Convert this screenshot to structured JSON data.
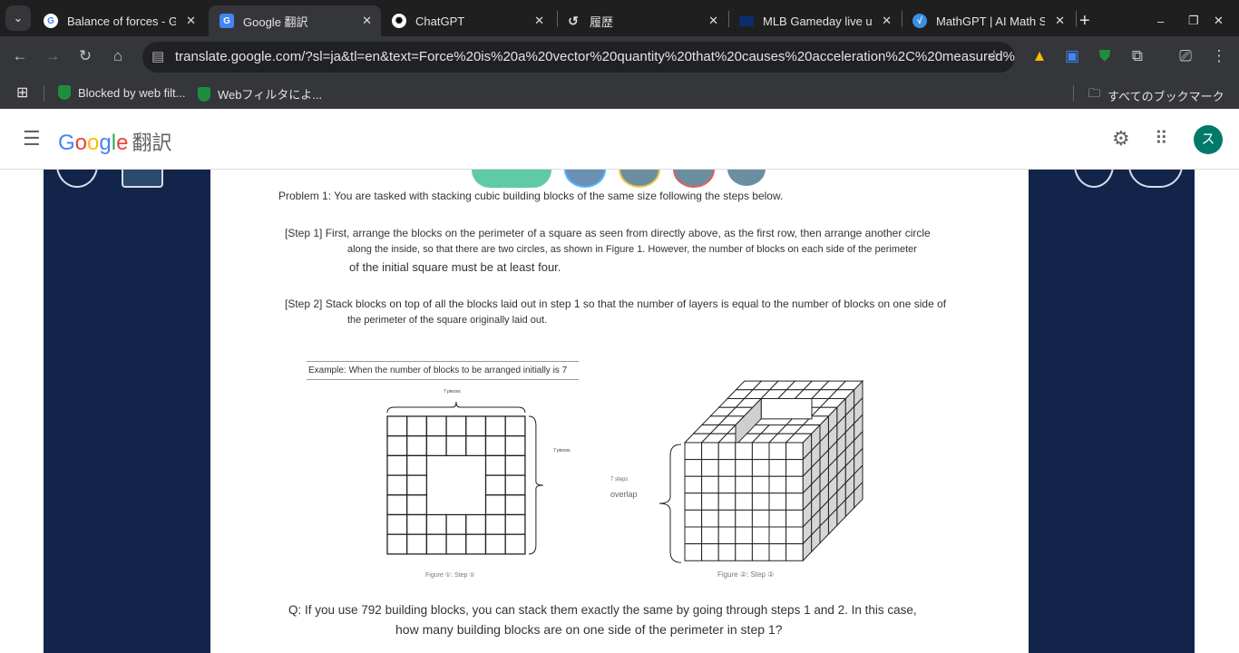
{
  "browser": {
    "tabs": [
      {
        "title": "Balance of forces - G",
        "icon": "google-icon"
      },
      {
        "title": "Google 翻訳",
        "icon": "google-translate-icon",
        "active": true
      },
      {
        "title": "ChatGPT",
        "icon": "chatgpt-icon"
      },
      {
        "title": "履歴",
        "icon": "history-icon"
      },
      {
        "title": "MLB Gameday live up",
        "icon": "mlb-icon"
      },
      {
        "title": "MathGPT | AI Math S",
        "icon": "mathgpt-icon"
      }
    ],
    "url": "translate.google.com/?sl=ja&tl=en&text=Force%20is%20a%20vector%20quantity%20that%20causes%20acceleration%2C%20measured%20i...",
    "bookmarks": [
      {
        "label": "Blocked by web filt..."
      },
      {
        "label": "Webフィルタによ..."
      }
    ],
    "all_bookmarks": "すべてのブックマーク"
  },
  "app": {
    "logo": "Google",
    "logo_suffix": "翻訳",
    "avatar": "ス",
    "accent": "#00796b"
  },
  "doc": {
    "problem": "Problem 1: You are tasked with stacking cubic building blocks of the same size following the steps below.",
    "step1": [
      "[Step 1] First, arrange the blocks on the perimeter of a square as seen from directly above, as the first row, then arrange another circle",
      "along the inside, so that there are two circles, as shown in Figure 1. However, the number of blocks on each side of the perimeter",
      "of the initial square must be at least four."
    ],
    "step2": [
      "[Step 2] Stack blocks on top of all the blocks laid out in step 1 so that the number of layers is equal to the number of blocks on one side of",
      "the perimeter of the square originally laid out."
    ],
    "example": "Example: When the number of blocks to be arranged initially is 7",
    "fig1_top": "7 pieces",
    "fig1_side": "7 pieces",
    "fig1_caption": "Figure ①: Step ①",
    "fig2_steps": "7 steps",
    "fig2_overlap": "overlap",
    "fig2_caption": "Figure ②: Step ②",
    "question": [
      "Q: If you use 792 building blocks, you can stack them exactly the same by going through steps 1 and 2. In this case,",
      "how many building blocks are on one side of the perimeter in step 1?"
    ]
  }
}
